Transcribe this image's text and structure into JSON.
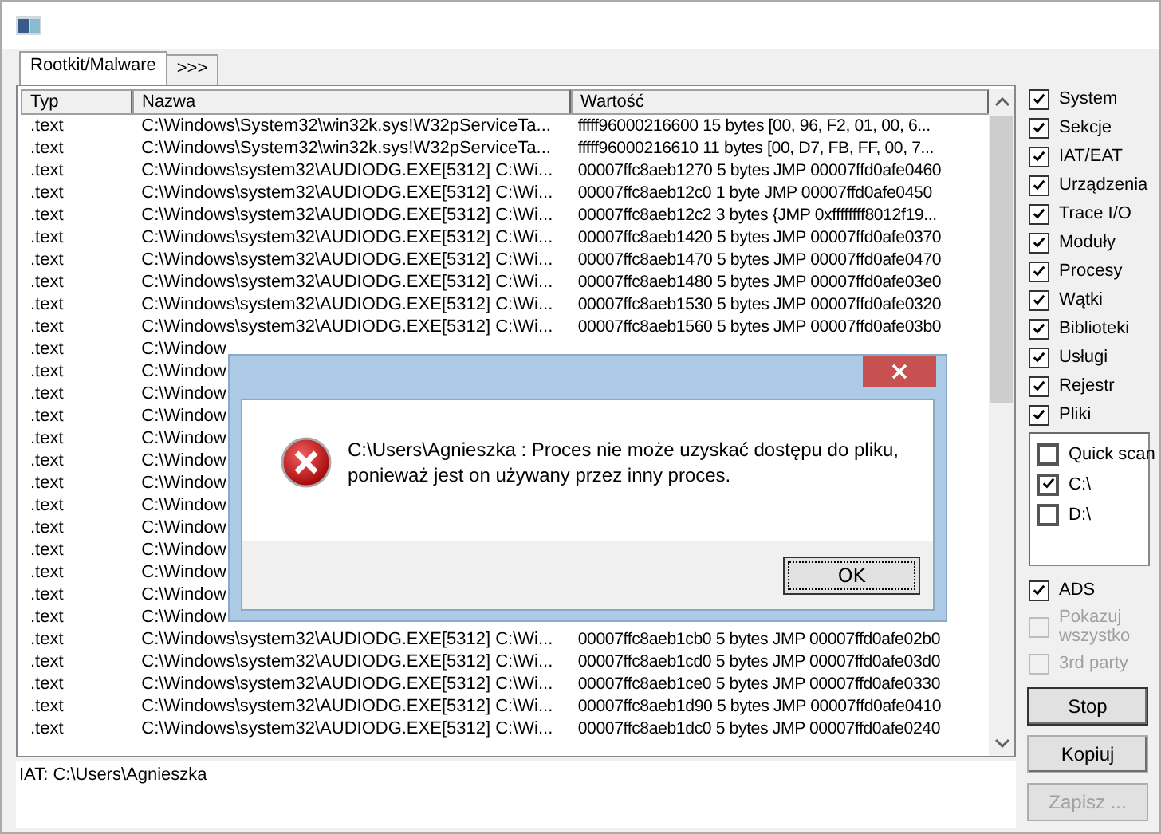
{
  "tabs": [
    {
      "label": "Rootkit/Malware",
      "selected": true
    },
    {
      "label": ">>>",
      "selected": false
    }
  ],
  "table": {
    "columns": [
      "Typ",
      "Nazwa",
      "Wartość"
    ],
    "rows": [
      {
        "type": ".text",
        "name": "C:\\Windows\\System32\\win32k.sys!W32pServiceTa...",
        "value": "fffff96000216600 15 bytes [00, 96, F2, 01, 00, 6..."
      },
      {
        "type": ".text",
        "name": "C:\\Windows\\System32\\win32k.sys!W32pServiceTa...",
        "value": "fffff96000216610 11 bytes [00, D7, FB, FF, 00, 7..."
      },
      {
        "type": ".text",
        "name": "C:\\Windows\\system32\\AUDIODG.EXE[5312] C:\\Wi...",
        "value": "00007ffc8aeb1270 5 bytes JMP 00007ffd0afe0460"
      },
      {
        "type": ".text",
        "name": "C:\\Windows\\system32\\AUDIODG.EXE[5312] C:\\Wi...",
        "value": "00007ffc8aeb12c0 1 byte JMP 00007ffd0afe0450"
      },
      {
        "type": ".text",
        "name": "C:\\Windows\\system32\\AUDIODG.EXE[5312] C:\\Wi...",
        "value": "00007ffc8aeb12c2 3 bytes {JMP 0xffffffff8012f19..."
      },
      {
        "type": ".text",
        "name": "C:\\Windows\\system32\\AUDIODG.EXE[5312] C:\\Wi...",
        "value": "00007ffc8aeb1420 5 bytes JMP 00007ffd0afe0370"
      },
      {
        "type": ".text",
        "name": "C:\\Windows\\system32\\AUDIODG.EXE[5312] C:\\Wi...",
        "value": "00007ffc8aeb1470 5 bytes JMP 00007ffd0afe0470"
      },
      {
        "type": ".text",
        "name": "C:\\Windows\\system32\\AUDIODG.EXE[5312] C:\\Wi...",
        "value": "00007ffc8aeb1480 5 bytes JMP 00007ffd0afe03e0"
      },
      {
        "type": ".text",
        "name": "C:\\Windows\\system32\\AUDIODG.EXE[5312] C:\\Wi...",
        "value": "00007ffc8aeb1530 5 bytes JMP 00007ffd0afe0320"
      },
      {
        "type": ".text",
        "name": "C:\\Windows\\system32\\AUDIODG.EXE[5312] C:\\Wi...",
        "value": "00007ffc8aeb1560 5 bytes JMP 00007ffd0afe03b0"
      },
      {
        "type": ".text",
        "name": "C:\\Window"
      },
      {
        "type": ".text",
        "name": "C:\\Window"
      },
      {
        "type": ".text",
        "name": "C:\\Window"
      },
      {
        "type": ".text",
        "name": "C:\\Window"
      },
      {
        "type": ".text",
        "name": "C:\\Window"
      },
      {
        "type": ".text",
        "name": "C:\\Window"
      },
      {
        "type": ".text",
        "name": "C:\\Window"
      },
      {
        "type": ".text",
        "name": "C:\\Window"
      },
      {
        "type": ".text",
        "name": "C:\\Window"
      },
      {
        "type": ".text",
        "name": "C:\\Window"
      },
      {
        "type": ".text",
        "name": "C:\\Window"
      },
      {
        "type": ".text",
        "name": "C:\\Window"
      },
      {
        "type": ".text",
        "name": "C:\\Window"
      },
      {
        "type": ".text",
        "name": "C:\\Windows\\system32\\AUDIODG.EXE[5312] C:\\Wi...",
        "value": "00007ffc8aeb1cb0 5 bytes JMP 00007ffd0afe02b0"
      },
      {
        "type": ".text",
        "name": "C:\\Windows\\system32\\AUDIODG.EXE[5312] C:\\Wi...",
        "value": "00007ffc8aeb1cd0 5 bytes JMP 00007ffd0afe03d0"
      },
      {
        "type": ".text",
        "name": "C:\\Windows\\system32\\AUDIODG.EXE[5312] C:\\Wi...",
        "value": "00007ffc8aeb1ce0 5 bytes JMP 00007ffd0afe0330"
      },
      {
        "type": ".text",
        "name": "C:\\Windows\\system32\\AUDIODG.EXE[5312] C:\\Wi...",
        "value": "00007ffc8aeb1d90 5 bytes JMP 00007ffd0afe0410"
      },
      {
        "type": ".text",
        "name": "C:\\Windows\\system32\\AUDIODG.EXE[5312] C:\\Wi...",
        "value": "00007ffc8aeb1dc0 5 bytes JMP 00007ffd0afe0240"
      }
    ]
  },
  "options": [
    {
      "label": "System",
      "checked": true
    },
    {
      "label": "Sekcje",
      "checked": true
    },
    {
      "label": "IAT/EAT",
      "checked": true
    },
    {
      "label": "Urządzenia",
      "checked": true
    },
    {
      "label": "Trace I/O",
      "checked": true
    },
    {
      "label": "Moduły",
      "checked": true
    },
    {
      "label": "Procesy",
      "checked": true
    },
    {
      "label": "Wątki",
      "checked": true
    },
    {
      "label": "Biblioteki",
      "checked": true
    },
    {
      "label": "Usługi",
      "checked": true
    },
    {
      "label": "Rejestr",
      "checked": true
    },
    {
      "label": "Pliki",
      "checked": true
    }
  ],
  "drives": [
    {
      "label": "Quick scan",
      "checked": false
    },
    {
      "label": "C:\\",
      "checked": true
    },
    {
      "label": "D:\\",
      "checked": false
    }
  ],
  "extra_options": [
    {
      "label": "ADS",
      "checked": true,
      "disabled": false
    },
    {
      "label": "Pokazuj wszystko",
      "checked": false,
      "disabled": true
    },
    {
      "label": "3rd party",
      "checked": false,
      "disabled": true
    }
  ],
  "buttons": [
    {
      "label": "Stop",
      "disabled": false
    },
    {
      "label": "Kopiuj",
      "disabled": false
    },
    {
      "label": "Zapisz ...",
      "disabled": true
    }
  ],
  "status_bar": "IAT: C:\\Users\\Agnieszka",
  "dialog": {
    "message": "C:\\Users\\Agnieszka : Proces nie może uzyskać dostępu do pliku,\nponieważ jest on używany przez inny proces.",
    "buttons": [
      "OK"
    ]
  }
}
